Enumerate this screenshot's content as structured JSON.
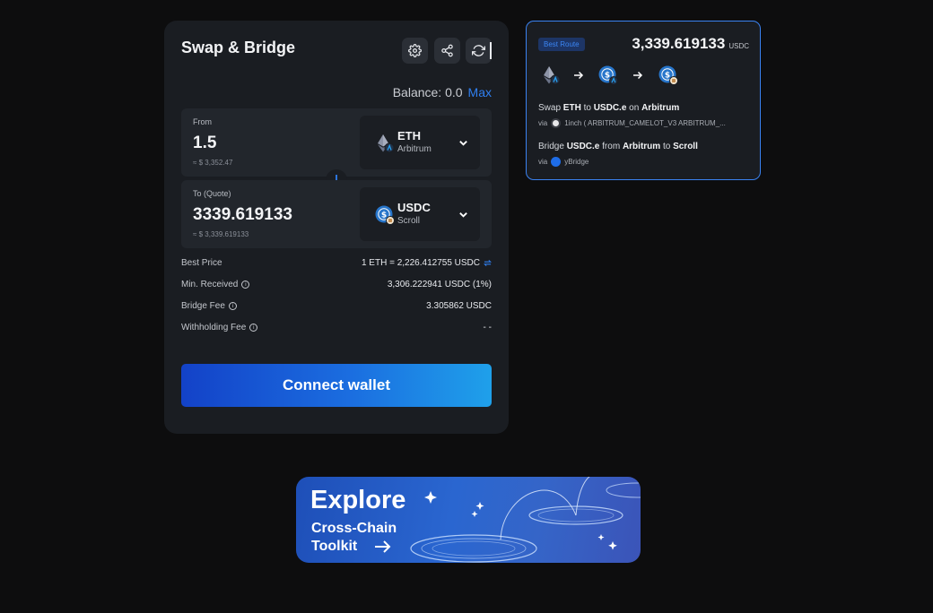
{
  "swap": {
    "title": "Swap & Bridge",
    "balance_label": "Balance: 0.0",
    "max_label": "Max",
    "from": {
      "label": "From",
      "amount": "1.5",
      "usd": "≈ $ 3,352.47",
      "token": "ETH",
      "network": "Arbitrum"
    },
    "to": {
      "label": "To (Quote)",
      "amount": "3339.619133",
      "usd": "≈ $ 3,339.619133",
      "token": "USDC",
      "network": "Scroll"
    },
    "info": [
      {
        "label": "Best Price",
        "value": "1 ETH = 2,226.412755 USDC"
      },
      {
        "label": "Min. Received",
        "value": "3,306.222941 USDC (1%)"
      },
      {
        "label": "Bridge Fee",
        "value": "3.305862 USDC"
      },
      {
        "label": "Withholding Fee",
        "value": "- -"
      }
    ],
    "connect_label": "Connect wallet"
  },
  "route": {
    "badge": "Best Route",
    "amount": "3,339.619133",
    "unit": "USDC",
    "step1": {
      "pre": "Swap",
      "token_from": "ETH",
      "mid": "to",
      "token_to": "USDC.e",
      "on": "on",
      "chain": "Arbitrum",
      "via_label": "via",
      "via_text": "1inch ( ARBITRUM_CAMELOT_V3 ARBITRUM_..."
    },
    "step2": {
      "pre": "Bridge",
      "token": "USDC.e",
      "from": "from",
      "chain_from": "Arbitrum",
      "to": "to",
      "chain_to": "Scroll",
      "via_label": "via",
      "via_text": "yBridge"
    }
  },
  "banner": {
    "title": "Explore",
    "line1": "Cross-Chain",
    "line2": "Toolkit"
  },
  "icons": {
    "settings": "gear-icon",
    "share": "share-icon",
    "refresh": "refresh-icon",
    "swap_direction": "arrow-down-icon",
    "chevron": "chevron-down-icon",
    "info": "info-icon"
  },
  "colors": {
    "accent": "#2f7ff0",
    "card_bg": "#1a1d22",
    "page_bg": "#0d0d0e",
    "usdc_blue": "#2775ca"
  }
}
